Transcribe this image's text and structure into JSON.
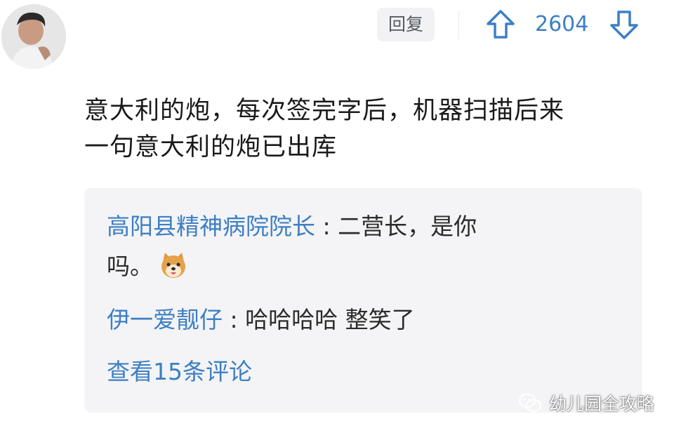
{
  "header": {
    "reply_label": "回复",
    "vote_count": "2604",
    "upvote_icon": "arrow-up-icon",
    "downvote_icon": "arrow-down-icon"
  },
  "comment": {
    "line1": "意大利的炮，每次签完字后，机器扫描后来",
    "line2": "一句意大利的炮已出库"
  },
  "replies": {
    "items": [
      {
        "author": "高阳县精神病院院长",
        "separator": " : ",
        "text_line1": "二营长，是你",
        "text_line2": "吗。"
      },
      {
        "author": "伊一爱靓仔",
        "separator": " : ",
        "text": "哈哈哈哈 整笑了"
      }
    ],
    "view_more": "查看15条评论"
  },
  "watermark": {
    "text": "幼儿园全攻略",
    "icon": "wechat-icon"
  },
  "colors": {
    "link_blue": "#3d7fc4",
    "reply_box_bg": "#f4f4f6",
    "text": "#1a1a1a"
  }
}
